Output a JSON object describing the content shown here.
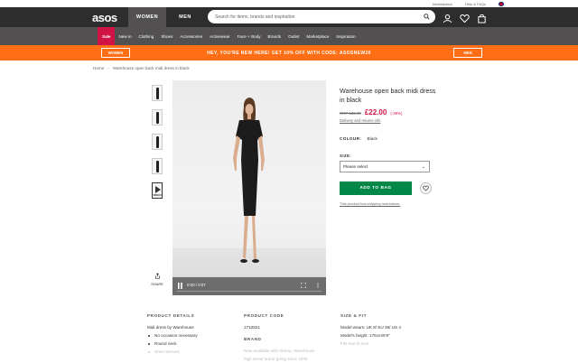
{
  "topstrip": {
    "marketplace": "Marketplace",
    "help": "Help & FAQs"
  },
  "header": {
    "logo": "asos",
    "tabs": [
      "WOMEN",
      "MEN"
    ],
    "search_placeholder": "Search for items, brands and inspiration"
  },
  "nav": {
    "items": [
      "Sale",
      "New in",
      "Clothing",
      "Shoes",
      "Accessories",
      "Activewear",
      "Face + Body",
      "Brands",
      "Outlet",
      "Marketplace",
      "Inspiration"
    ]
  },
  "promo": {
    "left_button": "WOMEN",
    "message": "HEY, YOU'RE NEW HERE! GET 10% OFF WITH CODE: ASOSNEW20",
    "right_button": "MEN"
  },
  "breadcrumb": {
    "home": "Home",
    "current": "Warehouse open back midi dress in black"
  },
  "thumbs": {
    "video_label": "VIDEO",
    "share": "SHARE"
  },
  "video": {
    "time": "0:00 / 0:07"
  },
  "product": {
    "title": "Warehouse open back midi dress in black",
    "rrp": "RRP £36.00",
    "price": "£22.00",
    "discount": "(-39%)",
    "delivery": "Delivery and returns info",
    "colour_label": "COLOUR:",
    "colour_value": "Black",
    "size_label": "SIZE:",
    "size_select": "Please select",
    "add_to_bag": "ADD TO BAG",
    "restrictions": "This product has shipping restrictions."
  },
  "details": {
    "product_details_heading": "PRODUCT DETAILS",
    "product_details_line": "Midi dress by Warehouse",
    "bullets": [
      "No occasion necessary",
      "Round neck",
      "Short sleeves"
    ],
    "product_code_heading": "PRODUCT CODE",
    "product_code": "1710821",
    "brand_heading": "BRAND",
    "brand_line1": "Now available with Klarna, Warehouse",
    "brand_line2": "high street brand going since 1976",
    "size_fit_heading": "SIZE & FIT",
    "model_wears": "Model wears: UK 8/ EU 36/ US 4",
    "model_height": "Model's height: 175cm/5'9\"",
    "faded_line": "Fits true to size"
  },
  "colors": {
    "accent_green": "#018849",
    "sale_red": "#d01345",
    "promo_orange": "#ff6e15",
    "header": "#2d2d2d"
  }
}
